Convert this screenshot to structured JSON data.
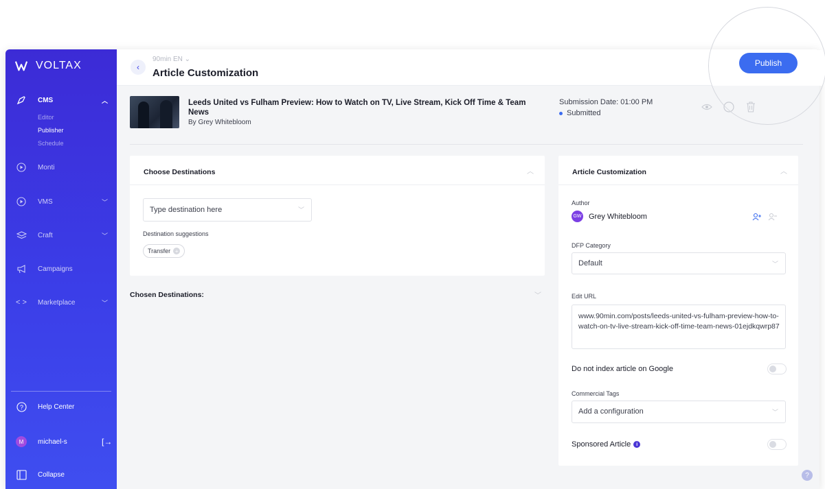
{
  "brand": {
    "name": "VOLTAX"
  },
  "sidebar": {
    "items": [
      {
        "label": "CMS",
        "icon": "pen-nib-icon"
      },
      {
        "label": "Monti",
        "icon": "play-circle-icon"
      },
      {
        "label": "VMS",
        "icon": "play-circle-icon"
      },
      {
        "label": "Craft",
        "icon": "layers-icon"
      },
      {
        "label": "Campaigns",
        "icon": "megaphone-icon"
      },
      {
        "label": "Marketplace",
        "icon": "code-brackets-icon"
      }
    ],
    "cms_sub": [
      "Editor",
      "Publisher",
      "Schedule"
    ],
    "help": "Help Center",
    "user": {
      "name": "michael-s",
      "initial": "M"
    },
    "collapse": "Collapse"
  },
  "header": {
    "breadcrumb": "90min EN ⌄",
    "title": "Article Customization",
    "publish": "Publish"
  },
  "article": {
    "title": "Leeds United vs Fulham Preview: How to Watch on TV, Live Stream, Kick Off Time & Team News",
    "author": "By Grey Whitebloom",
    "submission_date": "Submission Date: 01:00 PM",
    "status": "Submitted"
  },
  "destinations": {
    "heading": "Choose Destinations",
    "placeholder": "Type destination here",
    "suggestions_label": "Destination suggestions",
    "suggestion_chip": "Transfer",
    "chosen_label": "Chosen Destinations:"
  },
  "customization": {
    "heading": "Article Customization",
    "author_label": "Author",
    "author_name": "Grey Whitebloom",
    "author_initials": "GW",
    "dfp_label": "DFP Category",
    "dfp_value": "Default",
    "url_label": "Edit URL",
    "url_value": "www.90min.com/posts/leeds-united-vs-fulham-preview-how-to-watch-on-tv-live-stream-kick-off-time-team-news-01ejdkqwrp87",
    "noindex_label": "Do not index article on Google",
    "tags_label": "Commercial Tags",
    "tags_placeholder": "Add a configuration",
    "sponsored_label": "Sponsored Article"
  },
  "colors": {
    "sidebar": "#3b3ee8",
    "accent": "#3b6cf0",
    "status_dot": "#3b6cf0"
  }
}
